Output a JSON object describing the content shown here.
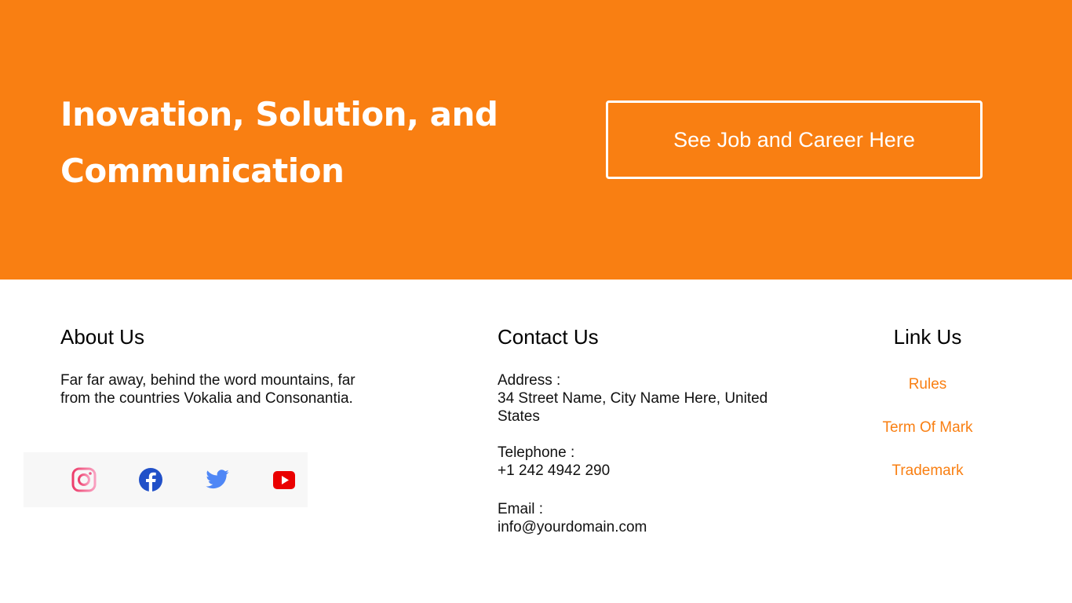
{
  "hero": {
    "title": "Inovation, Solution, and Communication",
    "cta": "See Job and Career Here"
  },
  "about": {
    "title": "About Us",
    "text": "Far far away, behind the word mountains, far from the countries Vokalia and Consonantia.",
    "social": [
      "instagram-icon",
      "facebook-icon",
      "twitter-icon",
      "youtube-icon"
    ]
  },
  "contact": {
    "title": "Contact Us",
    "address_label": "Address :",
    "address": "34 Street Name, City Name Here, United States",
    "phone_label": "Telephone :",
    "phone": "+1 242 4942 290",
    "email_label": "Email :",
    "email": "info@yourdomain.com"
  },
  "links": {
    "title": "Link Us",
    "items": [
      "Rules",
      "Term Of Mark",
      "Trademark"
    ]
  },
  "colors": {
    "accent": "#f97f12"
  }
}
